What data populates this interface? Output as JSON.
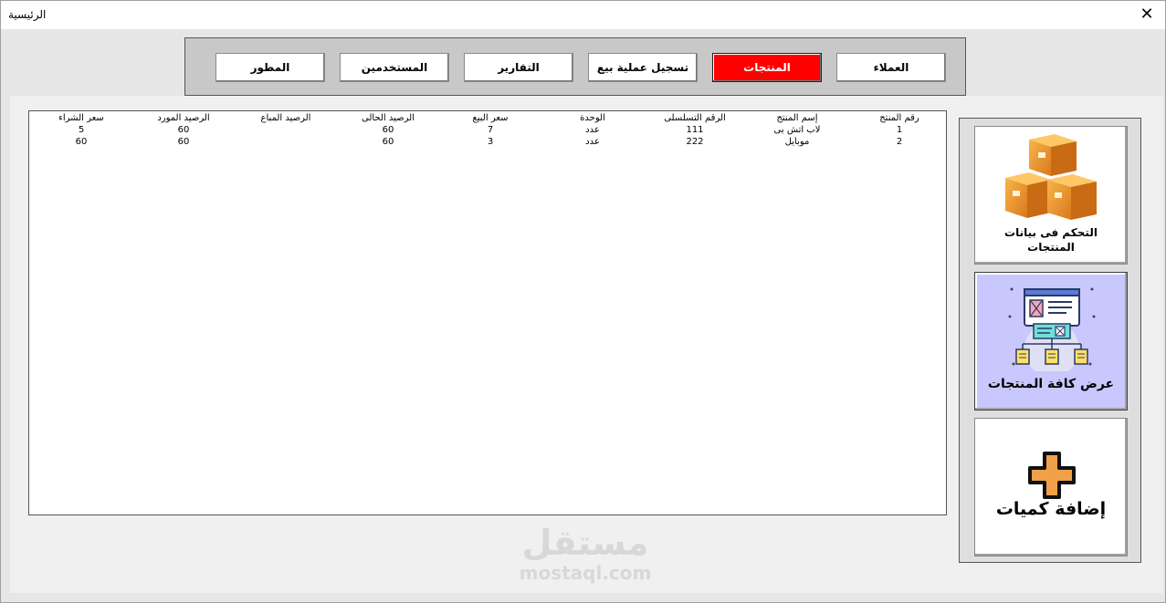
{
  "window": {
    "title": "الرئيسية",
    "close_glyph": "✕"
  },
  "nav": {
    "items": [
      {
        "label": "العملاء",
        "active": false
      },
      {
        "label": "المنتجات",
        "active": true
      },
      {
        "label": "تسجيل عملية بيع",
        "active": false
      },
      {
        "label": "التقارير",
        "active": false
      },
      {
        "label": "المستخدمين",
        "active": false
      },
      {
        "label": "المطور",
        "active": false
      }
    ],
    "active_color": "#ff0000"
  },
  "list": {
    "headers": [
      "رقم المنتج",
      "إسم المنتج",
      "الرقم التسلسلى",
      "الوحدة",
      "سعر البيع",
      "الرصيد الحالى",
      "الرصيد المباع",
      "الرصيد المورد",
      "سعر الشراء"
    ],
    "rows": [
      [
        "1",
        "لاب اتش بى",
        "111",
        "عدد",
        "7",
        "60",
        "",
        "60",
        "5"
      ],
      [
        "2",
        "موبايل",
        "222",
        "عدد",
        "3",
        "60",
        "",
        "60",
        "60"
      ]
    ]
  },
  "side": {
    "buttons": [
      {
        "label_line1": "التحكم فى بيانات",
        "label_line2": "المنتجات",
        "icon": "boxes-icon"
      },
      {
        "label_line1": "عرض كافة المنتجات",
        "label_line2": "",
        "icon": "product-list-icon",
        "selected": true
      },
      {
        "label_line1": "إضافة كميات",
        "label_line2": "",
        "icon": "plus-icon"
      }
    ],
    "selected_color": "#c8c8ff"
  },
  "watermark": {
    "text": "مستقل",
    "domain": "mostaql.com"
  }
}
